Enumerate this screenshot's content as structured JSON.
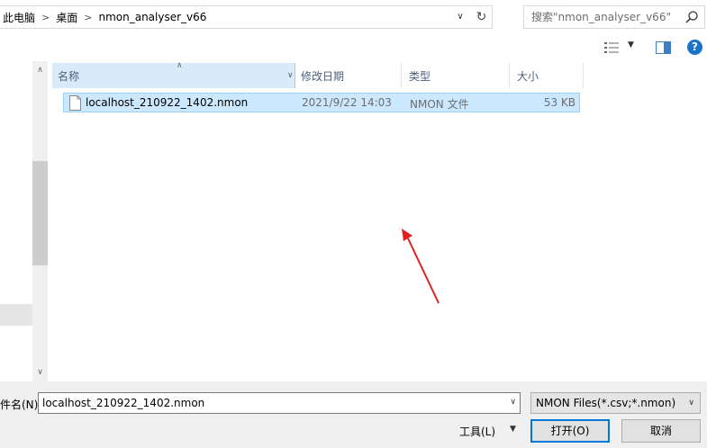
{
  "address": {
    "crumbs": [
      "此电脑",
      "桌面",
      "nmon_analyser_v66"
    ],
    "separator": ">",
    "search_placeholder": "搜索\"nmon_analyser_v66\""
  },
  "toolbar": {
    "view_icon": "view-options-icon",
    "pane_icon": "preview-pane-icon",
    "help_label": "?"
  },
  "file_list": {
    "columns": [
      "名称",
      "修改日期",
      "类型",
      "大小"
    ],
    "sort_column": "名称",
    "rows": [
      {
        "name": "localhost_210922_1402.nmon",
        "modified": "2021/9/22 14:03",
        "type": "NMON 文件",
        "size": "53 KB",
        "selected": true
      }
    ]
  },
  "annotation": {
    "arrow_color": "#e02020"
  },
  "bottom": {
    "filename_label": "件名(N):",
    "filename_value": "localhost_210922_1402.nmon",
    "filter_value": "NMON Files(*.csv;*.nmon)",
    "tools_label": "工具(L)",
    "open_label": "打开(O)",
    "cancel_label": "取消"
  },
  "colors": {
    "selection_bg": "#cce8ff",
    "selection_border": "#99d1ff",
    "accent": "#0078d7",
    "help_bg": "#1a73c8"
  }
}
